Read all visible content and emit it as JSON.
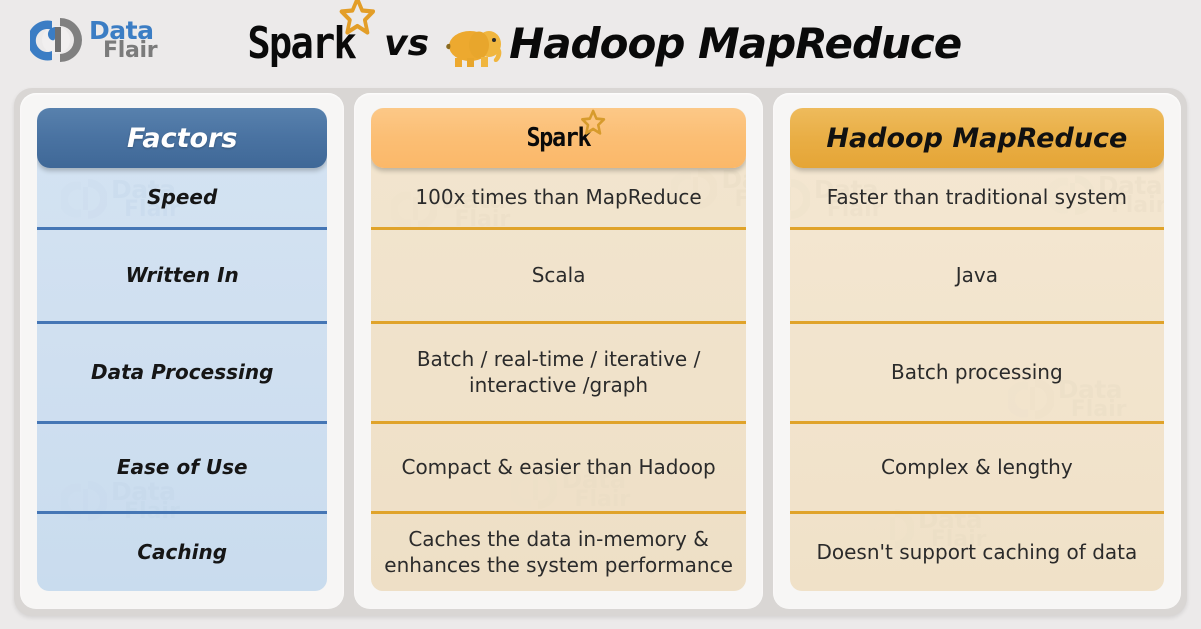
{
  "brand": {
    "name_top": "Data",
    "name_bottom": "Flair",
    "logo_icon": "dataflair-logo-icon",
    "blue": "#3b7dc4",
    "grey": "#7b7b7b"
  },
  "title": {
    "left_word": "Spark",
    "star_icon": "star-icon",
    "vs": "vs",
    "elephant_icon": "elephant-icon",
    "right_word": "Hadoop MapReduce"
  },
  "colors": {
    "factors_header": "#4a73a2",
    "factors_body": "#cfdff0",
    "factors_divider": "#4576b5",
    "spark_header": "#fbbe74",
    "spark_body": "#f0e2ca",
    "hadoop_header": "#e9ae45",
    "hadoop_body": "#f2e4cd",
    "divider_orange": "#e0a32a",
    "page_background": "#eceaea",
    "board_background": "#d9d6d4"
  },
  "watermark": {
    "top": "Data",
    "bottom": "Flair"
  },
  "table": {
    "columns": [
      {
        "key": "factors",
        "header": "Factors",
        "style": "blue"
      },
      {
        "key": "spark",
        "header": "Spark",
        "style": "orange-light",
        "icon": "star-icon"
      },
      {
        "key": "hadoop",
        "header": "Hadoop MapReduce",
        "style": "orange-dark"
      }
    ],
    "rows": [
      {
        "factor": "Speed",
        "spark": "100x times than MapReduce",
        "hadoop": "Faster than traditional system"
      },
      {
        "factor": "Written In",
        "spark": "Scala",
        "hadoop": "Java"
      },
      {
        "factor": "Data Processing",
        "spark": "Batch / real-time / iterative / interactive /graph",
        "hadoop": "Batch processing"
      },
      {
        "factor": "Ease of Use",
        "spark": "Compact & easier than Hadoop",
        "hadoop": "Complex & lengthy"
      },
      {
        "factor": "Caching",
        "spark": "Caches the data in-memory & enhances the system performance",
        "hadoop": "Doesn't support caching of data"
      }
    ]
  }
}
